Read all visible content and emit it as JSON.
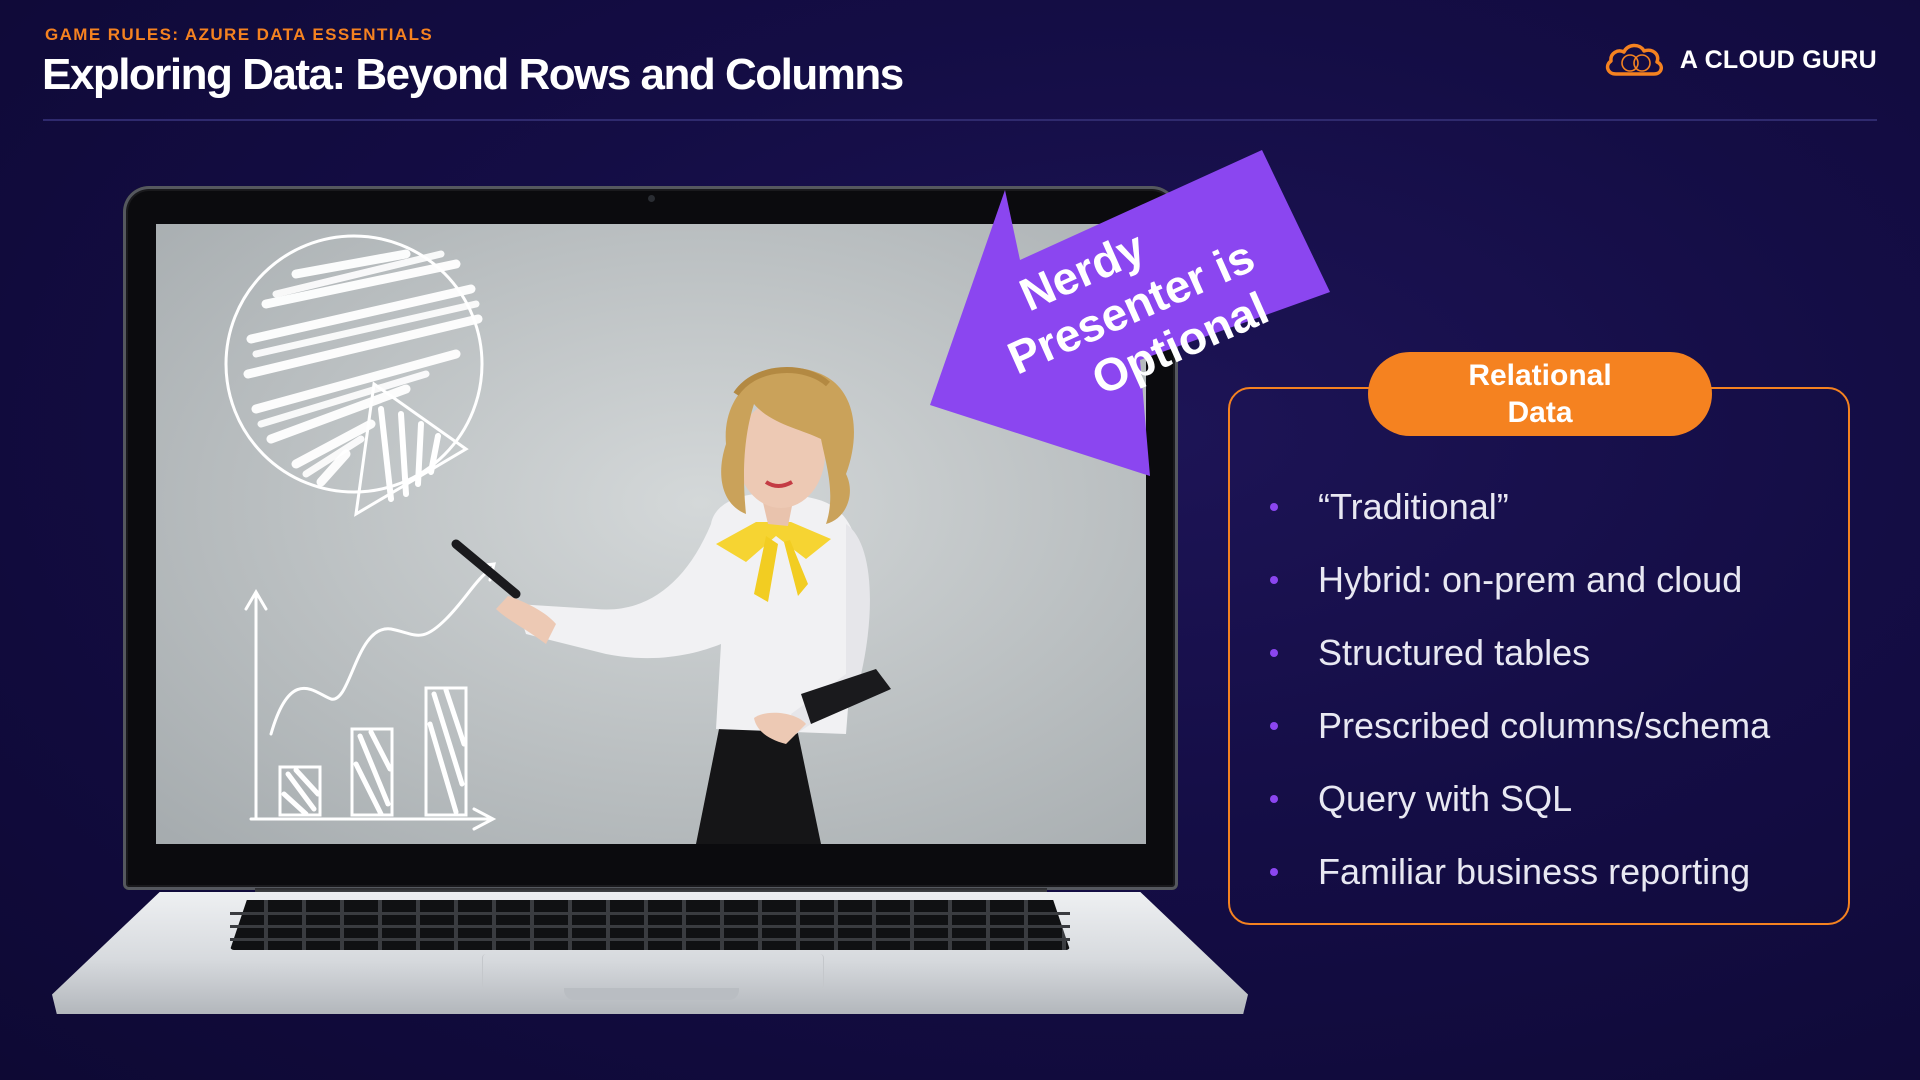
{
  "header": {
    "kicker": "GAME RULES: AZURE DATA ESSENTIALS",
    "title": "Exploring Data: Beyond Rows and Columns"
  },
  "brand": {
    "name": "A CLOUD GURU",
    "logo_icon": "cloud-logo-icon"
  },
  "callout": {
    "line1": "Nerdy",
    "line2": "Presenter is",
    "line3": "Optional",
    "color": "#8b46f0"
  },
  "card": {
    "title_line1": "Relational",
    "title_line2": "Data",
    "accent": "#f58220",
    "bullet_color": "#8b46f0",
    "items": [
      "“Traditional”",
      "Hybrid: on-prem and cloud",
      "Structured tables",
      "Prescribed columns/schema",
      "Query with SQL",
      "Familiar business reporting"
    ]
  }
}
